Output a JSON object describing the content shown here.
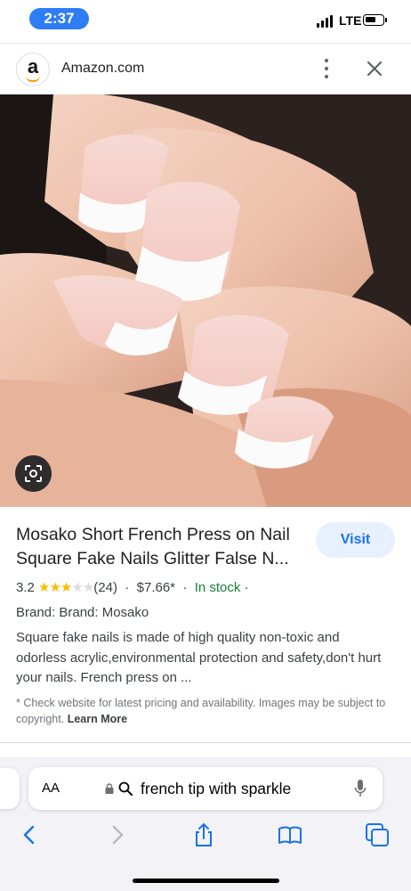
{
  "status": {
    "time": "2:37",
    "network": "LTE"
  },
  "site": {
    "name": "Amazon.com",
    "logo_letter": "a"
  },
  "result": {
    "title": "Mosako Short French Press on Nail Square Fake Nails Glitter False N...",
    "visit_label": "Visit",
    "rating": "3.2",
    "rating_value": 3.2,
    "review_count": "(24)",
    "price": "$7.66*",
    "availability": "In stock",
    "brand": "Brand: Brand: Mosako",
    "description": "Square fake nails is made of high quality non-toxic and odorless acrylic,environmental protection and safety,don't hurt your nails. French press on ...",
    "note": "* Check website for latest pricing and availability. Images may be subject to copyright.",
    "learn_more": "Learn More"
  },
  "toolbar": {
    "aa_label": "AA",
    "query": "french tip with sparkle"
  },
  "icons": [
    "kebab-menu-icon",
    "close-icon",
    "lens-icon",
    "star-icon",
    "lock-icon",
    "search-icon",
    "mic-icon",
    "back-icon",
    "forward-icon",
    "share-icon",
    "bookmarks-icon",
    "tabs-icon"
  ],
  "colors": {
    "accent": "#1a73e8",
    "instock": "#188038",
    "star": "#fbbc04",
    "time_pill": "#2e7cf6"
  }
}
